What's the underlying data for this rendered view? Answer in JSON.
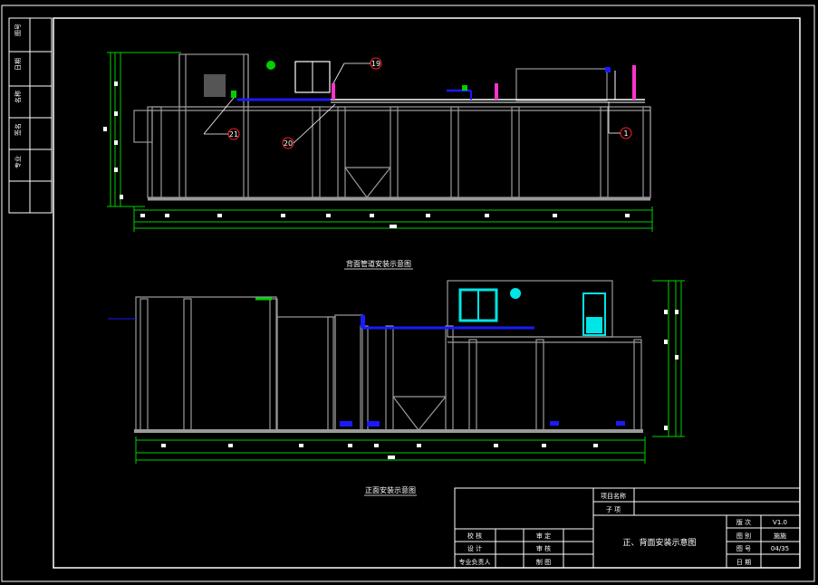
{
  "side_strip": {
    "labels": [
      "图号",
      "日期",
      "名称",
      "签名",
      "专业"
    ]
  },
  "drawing_titles": {
    "back_view": "背面管道安装示意图",
    "front_view": "正面安装示意图"
  },
  "back_view": {
    "callouts": [
      "19",
      "21",
      "20",
      "1"
    ]
  },
  "title_block": {
    "project_name_label": "项目名称",
    "sub_label": "子 项",
    "drawing_name": "正、背面安装示意图",
    "rows_left": [
      {
        "a": "校 核",
        "b": "审 定"
      },
      {
        "a": "设 计",
        "b": "审 核"
      },
      {
        "a": "专业负责人",
        "b": "制 图"
      }
    ],
    "rows_right": [
      {
        "label": "版 次",
        "value": "V1.0"
      },
      {
        "label": "图 别",
        "value": "施施"
      },
      {
        "label": "图 号",
        "value": "04/35"
      },
      {
        "label": "日 期",
        "value": ""
      }
    ]
  },
  "colors": {
    "frame": "#ffffff",
    "dimension": "#00d000",
    "pipe": "#1a1aff",
    "valve": "#ff33cc",
    "equipment": "#00e5e5",
    "wall": "#9a9a9a"
  }
}
